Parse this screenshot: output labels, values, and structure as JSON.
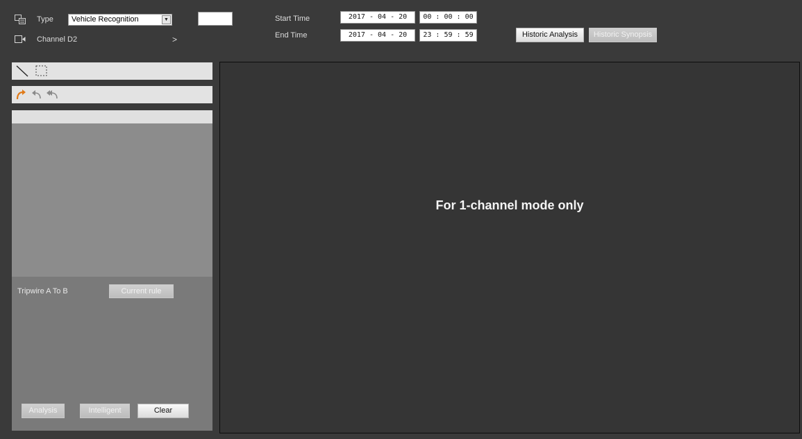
{
  "header": {
    "type_label": "Type",
    "type_value": "Vehicle Recognition",
    "channel_label": "Channel",
    "channel_value": "D2",
    "channel_arrow": ">",
    "start_label": "Start Time",
    "end_label": "End Time",
    "start": {
      "year": "2017",
      "month": "04",
      "day": "20",
      "hour": "00",
      "minute": "00",
      "second": "00"
    },
    "end": {
      "year": "2017",
      "month": "04",
      "day": "20",
      "hour": "23",
      "minute": "59",
      "second": "59"
    },
    "historic_analysis_label": "Historic Analysis",
    "historic_synopsis_label": "Historic Synopsis"
  },
  "left_panel": {
    "rule_label": "Tripwire A To B",
    "current_rule_label": "Current rule",
    "analysis_label": "Analysis",
    "intelligent_label": "Intelligent",
    "clear_label": "Clear"
  },
  "video": {
    "message": "For 1-channel mode only"
  },
  "icons": {
    "type": "type-icon",
    "channel": "camera-icon",
    "line_tool": "line-draw-icon",
    "rect_tool": "rect-draw-icon",
    "redo": "redo-icon",
    "undo": "undo-icon",
    "undo_all": "undo-all-icon"
  },
  "colors": {
    "background": "#3a3a3a",
    "video_bg": "#353535",
    "panel_light": "#e3e3e3",
    "list_bg": "#8c8c8c",
    "bottom_panel_bg": "#7a7a7a"
  }
}
